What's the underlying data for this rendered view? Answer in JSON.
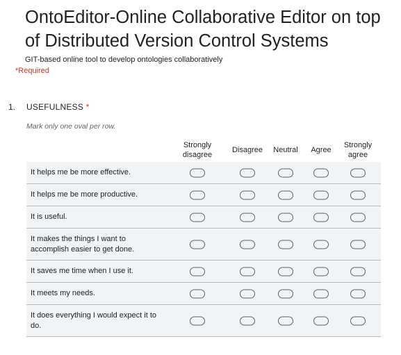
{
  "form": {
    "title": "OntoEditor-Online Collaborative Editor on top of Distributed Version Control Systems",
    "description": "GIT-based online tool to develop ontologies collaboratively",
    "required_note": "*Required"
  },
  "question": {
    "number": "1.",
    "title": "USEFULNESS",
    "required_mark": "*",
    "hint": "Mark only one oval per row.",
    "columns": [
      "Strongly\ndisagree",
      "Disagree",
      "Neutral",
      "Agree",
      "Strongly\nagree"
    ],
    "rows": [
      "It helps me be more effective.",
      "It helps me be more productive.",
      "It is useful.",
      "It makes the things I want to accomplish easier to get done.",
      "It saves me time when I use it.",
      "It meets my needs.",
      "It does everything I would expect it to do."
    ]
  }
}
